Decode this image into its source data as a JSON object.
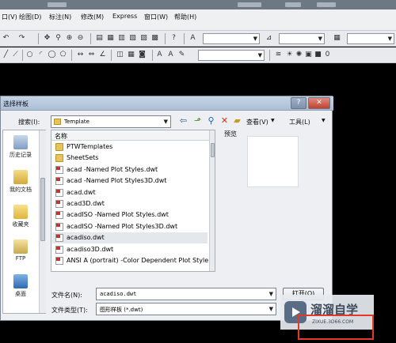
{
  "menubar": {
    "items": [
      "口(V)",
      "绘图(D)",
      "标注(N)",
      "修改(M)",
      "Express",
      "窗口(W)",
      "帮助(H)"
    ]
  },
  "dialog": {
    "title": "选择样板",
    "lookin_label": "搜索(I):",
    "lookin_value": "Template",
    "views_label": "查看(V)",
    "tools_label": "工具(L)",
    "col_header": "名称",
    "preview_label": "预览",
    "places": [
      {
        "label": "历史记录",
        "icon": "history-icon"
      },
      {
        "label": "我的文档",
        "icon": "my-documents-icon"
      },
      {
        "label": "收藏夹",
        "icon": "favorites-icon"
      },
      {
        "label": "FTP",
        "icon": "ftp-icon"
      },
      {
        "label": "桌面",
        "icon": "desktop-icon"
      }
    ],
    "files": [
      {
        "name": "PTWTemplates",
        "type": "folder"
      },
      {
        "name": "SheetSets",
        "type": "folder"
      },
      {
        "name": "acad -Named Plot Styles.dwt",
        "type": "dwt"
      },
      {
        "name": "acad -Named Plot Styles3D.dwt",
        "type": "dwt"
      },
      {
        "name": "acad.dwt",
        "type": "dwt"
      },
      {
        "name": "acad3D.dwt",
        "type": "dwt"
      },
      {
        "name": "acadISO -Named Plot Styles.dwt",
        "type": "dwt"
      },
      {
        "name": "acadISO -Named Plot Styles3D.dwt",
        "type": "dwt"
      },
      {
        "name": "acadiso.dwt",
        "type": "dwt",
        "selected": true
      },
      {
        "name": "acadiso3D.dwt",
        "type": "dwt"
      },
      {
        "name": "ANSI A (portrait) -Color Dependent Plot Style",
        "type": "dwt"
      }
    ],
    "filename_label": "文件名(N):",
    "filename_value": "acadiso.dwt",
    "filetype_label": "文件类型(T):",
    "filetype_value": "图形样板 (*.dwt)",
    "open_button": "打开(O)"
  },
  "watermark": {
    "brand": "溜溜自学",
    "url": "ZIXUE.3D66.COM"
  },
  "colors": {
    "dialog_bg": "#edeff2",
    "title_gradient_top": "#c4d3e6",
    "close_red": "#c2412f",
    "highlight_box": "#e23a2a"
  }
}
